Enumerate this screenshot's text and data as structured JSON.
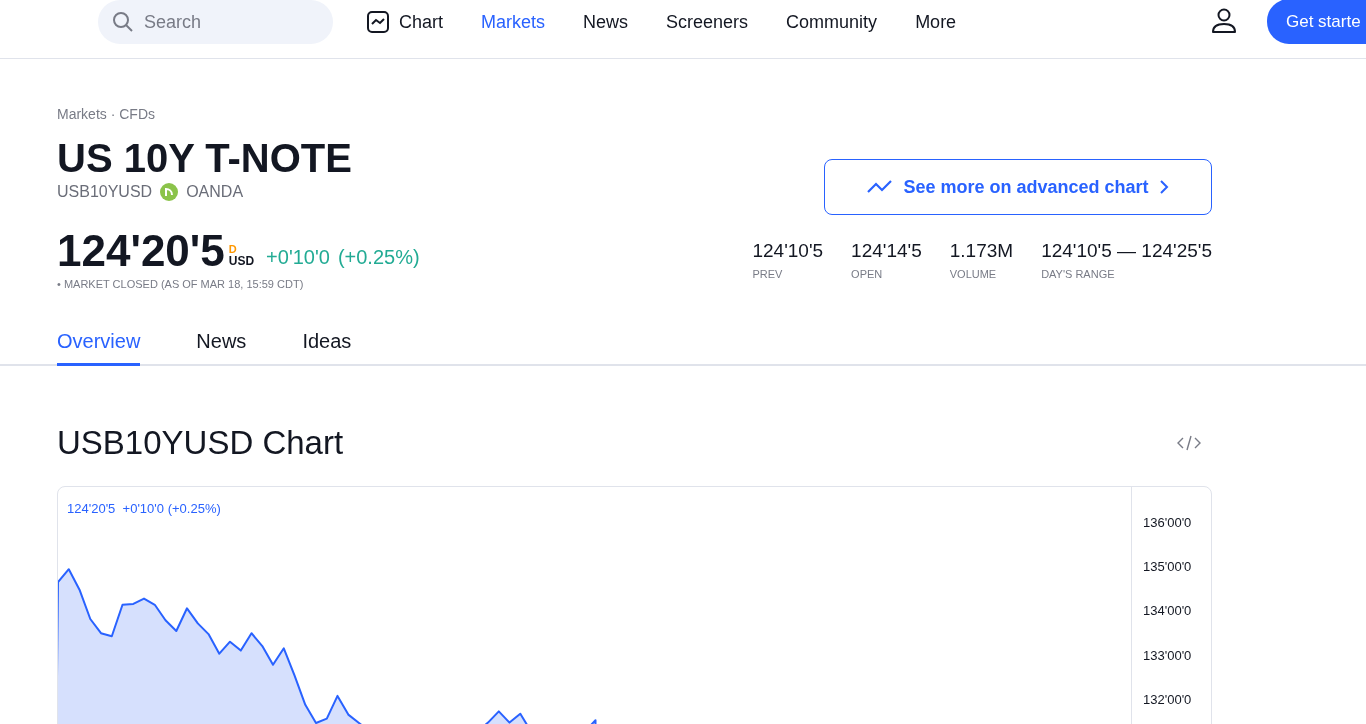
{
  "nav": {
    "search": {
      "placeholder": "Search"
    },
    "items": [
      {
        "label": "Chart",
        "kind": "chart",
        "selected": false
      },
      {
        "label": "Markets",
        "kind": "link",
        "selected": true
      },
      {
        "label": "News",
        "kind": "link",
        "selected": false
      },
      {
        "label": "Screeners",
        "kind": "link",
        "selected": false
      },
      {
        "label": "Community",
        "kind": "link",
        "selected": false
      },
      {
        "label": "More",
        "kind": "link",
        "selected": false
      }
    ],
    "cta": "Get starte"
  },
  "header": {
    "breadcrumb": "Markets · CFDs",
    "title": "US 10Y T-NOTE",
    "symbol": "USB10YUSD",
    "exchange": "OANDA",
    "price": "124'20'5",
    "price_flag": "D",
    "currency": "USD",
    "change": "+0'10'0",
    "change_pct": "(+0.25%)",
    "status": "• MARKET CLOSED (AS OF MAR 18, 15:59 CDT)",
    "advanced_button": "See more on advanced chart",
    "stats": [
      {
        "value": "124'10'5",
        "label": "PREV"
      },
      {
        "value": "124'14'5",
        "label": "OPEN"
      },
      {
        "value": "1.173M",
        "label": "VOLUME"
      },
      {
        "value": "124'10'5 — 124'25'5",
        "label": "DAY'S RANGE"
      }
    ]
  },
  "tabs": [
    {
      "label": "Overview",
      "selected": true
    },
    {
      "label": "News",
      "selected": false
    },
    {
      "label": "Ideas",
      "selected": false
    }
  ],
  "chart_section": {
    "title": "USB10YUSD Chart",
    "legend": "124'20'5  +0'10'0 (+0.25%)",
    "axis_labels": [
      "136'00'0",
      "135'00'0",
      "134'00'0",
      "133'00'0",
      "132'00'0"
    ]
  }
}
